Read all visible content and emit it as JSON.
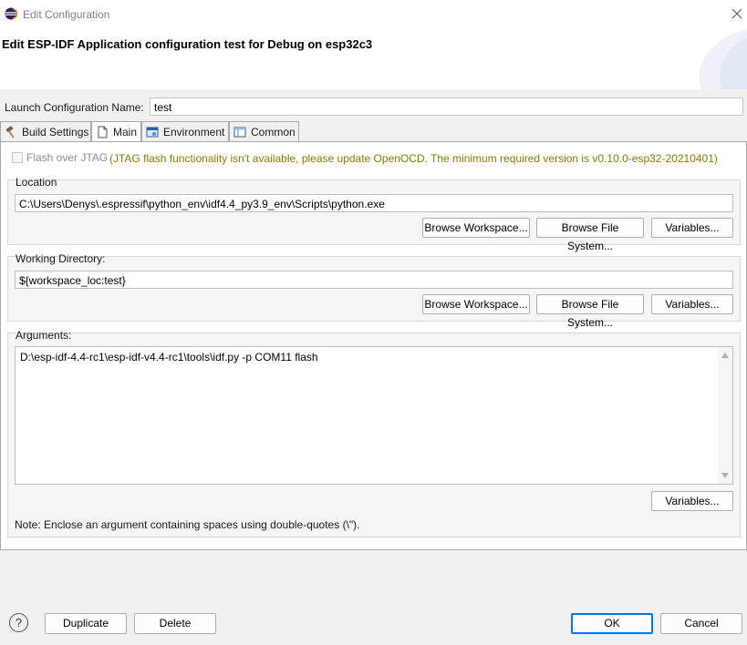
{
  "window": {
    "title": "Edit Configuration",
    "header_title": "Edit ESP-IDF Application configuration test for Debug on esp32c3"
  },
  "launch_config": {
    "label": "Launch Configuration Name:",
    "value": "test"
  },
  "tabs": [
    {
      "label": "Build Settings",
      "icon": "hammer-icon",
      "active": false
    },
    {
      "label": "Main",
      "icon": "page-icon",
      "active": true
    },
    {
      "label": "Environment",
      "icon": "environment-icon",
      "active": false
    },
    {
      "label": "Common",
      "icon": "table-icon",
      "active": false
    }
  ],
  "main": {
    "flash_checkbox_label": "Flash over JTAG",
    "flash_checked": false,
    "warning": "(JTAG flash functionality isn't available, please update OpenOCD. The minimum required version is v0.10.0-esp32-20210401)",
    "location": {
      "label": "Location",
      "value": "C:\\Users\\Denys\\.espressif\\python_env\\idf4.4_py3.9_env\\Scripts\\python.exe",
      "browse_workspace": "Browse Workspace...",
      "browse_fs": "Browse File System...",
      "variables": "Variables..."
    },
    "working_dir": {
      "label": "Working Directory:",
      "value": "${workspace_loc:test}",
      "browse_workspace": "Browse Workspace...",
      "browse_fs": "Browse File System...",
      "variables": "Variables..."
    },
    "arguments": {
      "label": "Arguments:",
      "value": "D:\\esp-idf-4.4-rc1\\esp-idf-v4.4-rc1\\tools\\idf.py -p COM11 flash",
      "variables": "Variables...",
      "note": "Note: Enclose an argument containing spaces using double-quotes (\\\")."
    }
  },
  "footer": {
    "help": "?",
    "duplicate": "Duplicate",
    "delete": "Delete",
    "ok": "OK",
    "cancel": "Cancel"
  },
  "colors": {
    "warning_text": "#8a7a00",
    "default_button_border": "#0078d7"
  }
}
